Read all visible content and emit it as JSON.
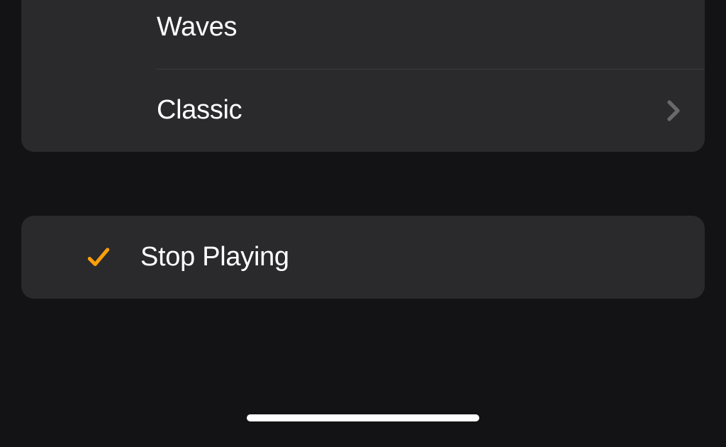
{
  "topSection": {
    "items": [
      {
        "label": "Waves",
        "hasChevron": false,
        "hasSeparator": true
      },
      {
        "label": "Classic",
        "hasChevron": true,
        "hasSeparator": true
      }
    ]
  },
  "bottomSection": {
    "items": [
      {
        "label": "Stop Playing",
        "checked": true
      }
    ]
  },
  "colors": {
    "accent": "#ff9f0a",
    "chevron": "#8e8e93"
  }
}
